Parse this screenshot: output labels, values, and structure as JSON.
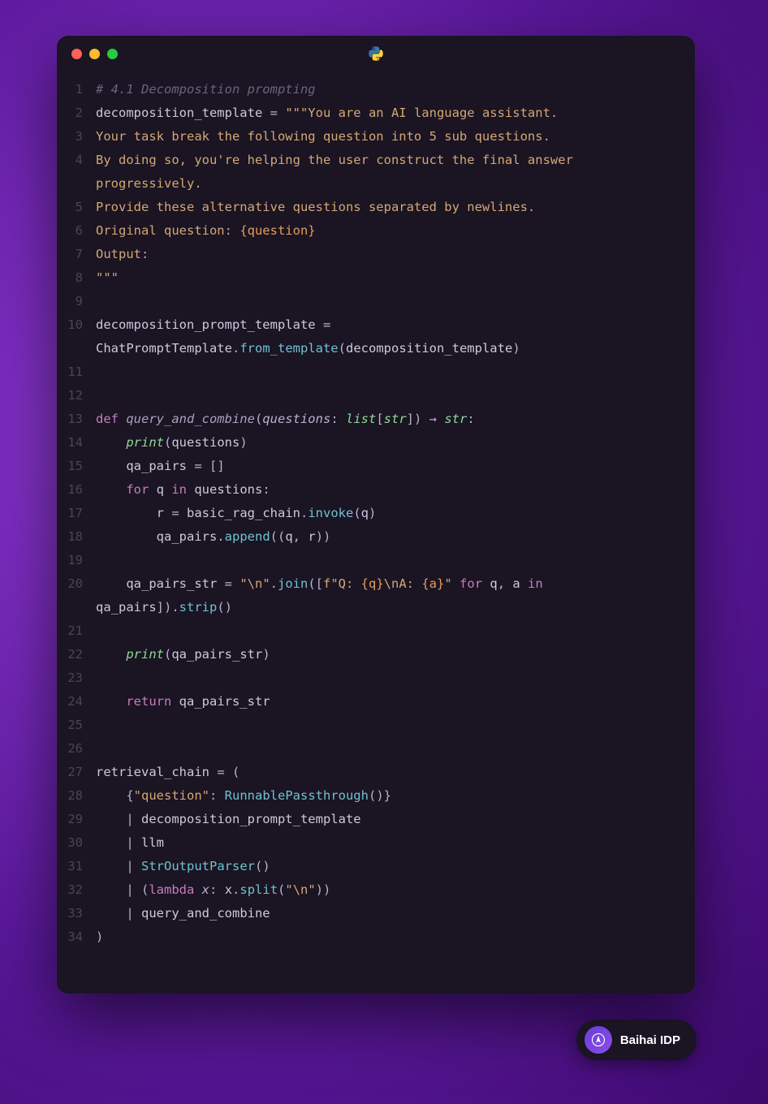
{
  "window": {
    "language_icon": "python-icon"
  },
  "code_lines": [
    {
      "n": "1",
      "tokens": [
        [
          "c-comment",
          "# 4.1 Decomposition prompting"
        ]
      ]
    },
    {
      "n": "2",
      "tokens": [
        [
          "c-var",
          "decomposition_template "
        ],
        [
          "c-op",
          "= "
        ],
        [
          "c-str",
          "\"\"\"You are an AI language assistant."
        ]
      ]
    },
    {
      "n": "3",
      "tokens": [
        [
          "c-str",
          "Your task break the following question into 5 sub questions."
        ]
      ]
    },
    {
      "n": "4",
      "tokens": [
        [
          "c-str",
          "By doing so, you're helping the user construct the final answer progressively."
        ]
      ]
    },
    {
      "n": "5",
      "tokens": [
        [
          "c-str",
          "Provide these alternative questions separated by newlines."
        ]
      ]
    },
    {
      "n": "6",
      "tokens": [
        [
          "c-str",
          "Original question: "
        ],
        [
          "c-strfmt",
          "{question}"
        ]
      ]
    },
    {
      "n": "7",
      "tokens": [
        [
          "c-str",
          "Output:"
        ]
      ]
    },
    {
      "n": "8",
      "tokens": [
        [
          "c-str",
          "\"\"\""
        ]
      ]
    },
    {
      "n": "9",
      "tokens": []
    },
    {
      "n": "10",
      "tokens": [
        [
          "c-var",
          "decomposition_prompt_template "
        ],
        [
          "c-op",
          "= "
        ],
        [
          "c-var",
          "ChatPromptTemplate"
        ],
        [
          "c-punct",
          "."
        ],
        [
          "c-call",
          "from_template"
        ],
        [
          "c-punct",
          "("
        ],
        [
          "c-var",
          "decomposition_template"
        ],
        [
          "c-punct",
          ")"
        ]
      ]
    },
    {
      "n": "11",
      "tokens": []
    },
    {
      "n": "12",
      "tokens": []
    },
    {
      "n": "13",
      "tokens": [
        [
          "c-kw",
          "def "
        ],
        [
          "c-fnname",
          "query_and_combine"
        ],
        [
          "c-punct",
          "("
        ],
        [
          "c-param",
          "questions"
        ],
        [
          "c-punct",
          ": "
        ],
        [
          "c-type",
          "list"
        ],
        [
          "c-punct",
          "["
        ],
        [
          "c-type",
          "str"
        ],
        [
          "c-punct",
          "]) "
        ],
        [
          "c-op",
          "→ "
        ],
        [
          "c-type",
          "str"
        ],
        [
          "c-punct",
          ":"
        ]
      ]
    },
    {
      "n": "14",
      "tokens": [
        [
          "",
          "    "
        ],
        [
          "c-builtin",
          "print"
        ],
        [
          "c-punct",
          "("
        ],
        [
          "c-var",
          "questions"
        ],
        [
          "c-punct",
          ")"
        ]
      ]
    },
    {
      "n": "15",
      "tokens": [
        [
          "",
          "    "
        ],
        [
          "c-var",
          "qa_pairs "
        ],
        [
          "c-op",
          "= "
        ],
        [
          "c-punct",
          "[]"
        ]
      ]
    },
    {
      "n": "16",
      "tokens": [
        [
          "",
          "    "
        ],
        [
          "c-kw",
          "for "
        ],
        [
          "c-var",
          "q "
        ],
        [
          "c-kw",
          "in "
        ],
        [
          "c-var",
          "questions"
        ],
        [
          "c-punct",
          ":"
        ]
      ]
    },
    {
      "n": "17",
      "tokens": [
        [
          "",
          "        "
        ],
        [
          "c-var",
          "r "
        ],
        [
          "c-op",
          "= "
        ],
        [
          "c-var",
          "basic_rag_chain"
        ],
        [
          "c-punct",
          "."
        ],
        [
          "c-call",
          "invoke"
        ],
        [
          "c-punct",
          "("
        ],
        [
          "c-var",
          "q"
        ],
        [
          "c-punct",
          ")"
        ]
      ]
    },
    {
      "n": "18",
      "tokens": [
        [
          "",
          "        "
        ],
        [
          "c-var",
          "qa_pairs"
        ],
        [
          "c-punct",
          "."
        ],
        [
          "c-call",
          "append"
        ],
        [
          "c-punct",
          "(("
        ],
        [
          "c-var",
          "q"
        ],
        [
          "c-punct",
          ", "
        ],
        [
          "c-var",
          "r"
        ],
        [
          "c-punct",
          "))"
        ]
      ]
    },
    {
      "n": "19",
      "tokens": []
    },
    {
      "n": "20",
      "tokens": [
        [
          "",
          "    "
        ],
        [
          "c-var",
          "qa_pairs_str "
        ],
        [
          "c-op",
          "= "
        ],
        [
          "c-str",
          "\"\\n\""
        ],
        [
          "c-punct",
          "."
        ],
        [
          "c-call",
          "join"
        ],
        [
          "c-punct",
          "(["
        ],
        [
          "c-fstr",
          "f"
        ],
        [
          "c-str",
          "\"Q: "
        ],
        [
          "c-strfmt",
          "{q}"
        ],
        [
          "c-str",
          "\\nA: "
        ],
        [
          "c-strfmt",
          "{a}"
        ],
        [
          "c-str",
          "\""
        ],
        [
          "c-punct",
          " "
        ],
        [
          "c-kw",
          "for "
        ],
        [
          "c-var",
          "q"
        ],
        [
          "c-punct",
          ", "
        ],
        [
          "c-var",
          "a "
        ],
        [
          "c-kw",
          "in "
        ],
        [
          "c-var",
          "qa_pairs"
        ],
        [
          "c-punct",
          "])."
        ],
        [
          "c-call",
          "strip"
        ],
        [
          "c-punct",
          "()"
        ]
      ]
    },
    {
      "n": "21",
      "tokens": []
    },
    {
      "n": "22",
      "tokens": [
        [
          "",
          "    "
        ],
        [
          "c-builtin",
          "print"
        ],
        [
          "c-punct",
          "("
        ],
        [
          "c-var",
          "qa_pairs_str"
        ],
        [
          "c-punct",
          ")"
        ]
      ]
    },
    {
      "n": "23",
      "tokens": []
    },
    {
      "n": "24",
      "tokens": [
        [
          "",
          "    "
        ],
        [
          "c-kw-ret",
          "return "
        ],
        [
          "c-var",
          "qa_pairs_str"
        ]
      ]
    },
    {
      "n": "25",
      "tokens": []
    },
    {
      "n": "26",
      "tokens": []
    },
    {
      "n": "27",
      "tokens": [
        [
          "c-var",
          "retrieval_chain "
        ],
        [
          "c-op",
          "= "
        ],
        [
          "c-punct",
          "("
        ]
      ]
    },
    {
      "n": "28",
      "tokens": [
        [
          "",
          "    "
        ],
        [
          "c-punct",
          "{"
        ],
        [
          "c-key",
          "\"question\""
        ],
        [
          "c-punct",
          ": "
        ],
        [
          "c-class",
          "RunnablePassthrough"
        ],
        [
          "c-punct",
          "()}"
        ]
      ]
    },
    {
      "n": "29",
      "tokens": [
        [
          "",
          "    "
        ],
        [
          "c-op",
          "| "
        ],
        [
          "c-var",
          "decomposition_prompt_template"
        ]
      ]
    },
    {
      "n": "30",
      "tokens": [
        [
          "",
          "    "
        ],
        [
          "c-op",
          "| "
        ],
        [
          "c-var",
          "llm"
        ]
      ]
    },
    {
      "n": "31",
      "tokens": [
        [
          "",
          "    "
        ],
        [
          "c-op",
          "| "
        ],
        [
          "c-class",
          "StrOutputParser"
        ],
        [
          "c-punct",
          "()"
        ]
      ]
    },
    {
      "n": "32",
      "tokens": [
        [
          "",
          "    "
        ],
        [
          "c-op",
          "| "
        ],
        [
          "c-punct",
          "("
        ],
        [
          "c-kw",
          "lambda "
        ],
        [
          "c-param",
          "x"
        ],
        [
          "c-punct",
          ": "
        ],
        [
          "c-var",
          "x"
        ],
        [
          "c-punct",
          "."
        ],
        [
          "c-call",
          "split"
        ],
        [
          "c-punct",
          "("
        ],
        [
          "c-str",
          "\"\\n\""
        ],
        [
          "c-punct",
          "))"
        ]
      ]
    },
    {
      "n": "33",
      "tokens": [
        [
          "",
          "    "
        ],
        [
          "c-op",
          "| "
        ],
        [
          "c-var",
          "query_and_combine"
        ]
      ]
    },
    {
      "n": "34",
      "tokens": [
        [
          "c-punct",
          ")"
        ]
      ]
    }
  ],
  "badge": {
    "text": "Baihai IDP"
  }
}
